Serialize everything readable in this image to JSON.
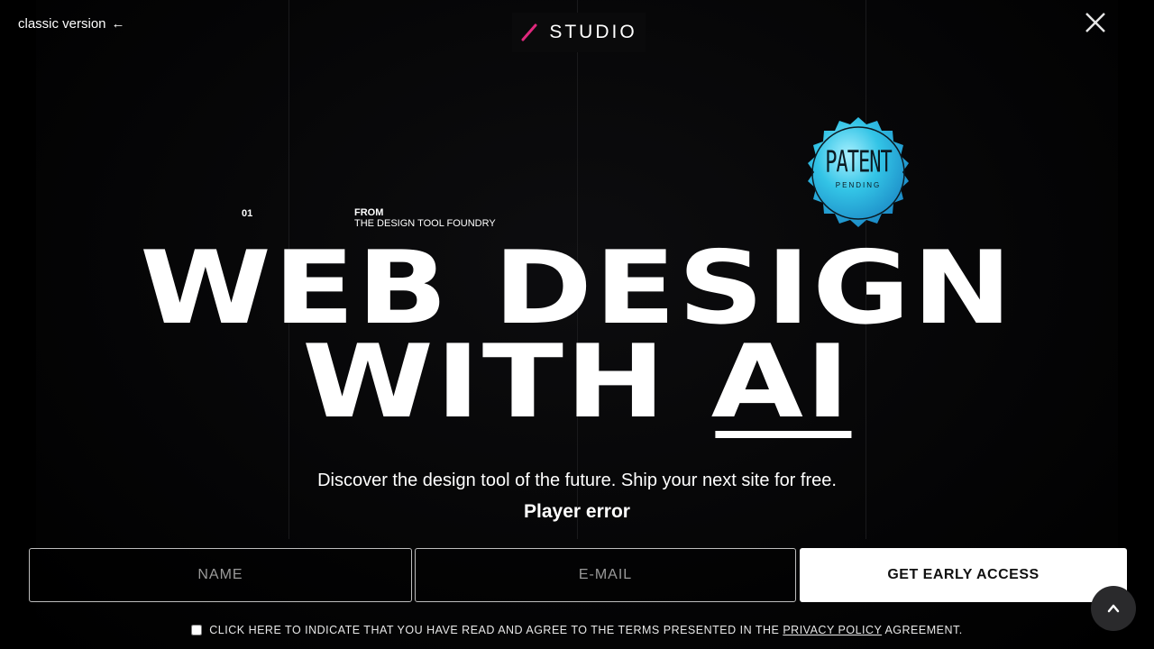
{
  "header": {
    "classic_label": "classic version",
    "classic_arrow": "←",
    "logo_text": "STUDIO",
    "brand_accent": "#e0287d"
  },
  "badge": {
    "line1": "PATENT",
    "line2": "PENDING",
    "color": "#2bb8d8"
  },
  "intro": {
    "number": "01",
    "from_label": "FROM",
    "from_value": "THE DESIGN TOOL FOUNDRY"
  },
  "hero": {
    "line1": "WEB DESIGN",
    "line2_prefix": "WITH ",
    "line2_highlight": "AI",
    "subtitle": "Discover the design tool of the future. Ship your next site for free.",
    "player_error": "Player error"
  },
  "form": {
    "name_placeholder": "NAME",
    "email_placeholder": "E-MAIL",
    "submit_label": "GET EARLY ACCESS",
    "consent_before": "CLICK HERE TO INDICATE THAT YOU HAVE READ AND AGREE TO THE TERMS PRESENTED IN THE ",
    "consent_link": "PRIVACY POLICY",
    "consent_after": " AGREEMENT."
  },
  "icons": {
    "close": "close-icon",
    "scroll_top": "chevron-up-icon",
    "logo_mark": "slash-icon"
  }
}
